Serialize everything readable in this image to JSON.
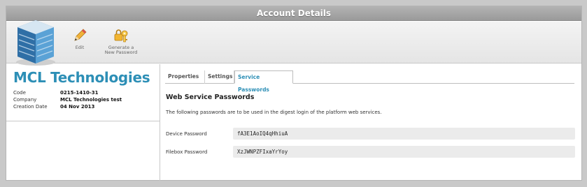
{
  "window": {
    "title": "Account Details"
  },
  "toolbar": {
    "edit_label": "Edit",
    "generate_label_line1": "Generate a",
    "generate_label_line2": "New Password"
  },
  "account": {
    "name": "MCL Technologies",
    "fields": [
      {
        "label": "Code",
        "value": "0215-1410-31"
      },
      {
        "label": "Company",
        "value": "MCL Technologies test"
      },
      {
        "label": "Creation Date",
        "value": "04 Nov 2013"
      }
    ]
  },
  "tabs": [
    {
      "label": "Properties",
      "active": false
    },
    {
      "label": "Settings",
      "active": false
    },
    {
      "label": "Service Passwords",
      "active": true
    }
  ],
  "service_passwords": {
    "title": "Web Service Passwords",
    "description": "The following passwords are to be used in the digest login of the platform web services.",
    "device": {
      "label": "Device Password",
      "value": "fA3E1AoIQ4qHhiuA"
    },
    "filebox": {
      "label": "Filebox Password",
      "value": "XzJWNPZFIxaYrYoy"
    }
  },
  "colors": {
    "accent": "#2d8fb6",
    "titlebar": "#a8a8a8",
    "field_bg": "#ebebeb"
  },
  "icons": [
    "building-logo-icon",
    "pencil-icon",
    "key-lock-icon"
  ]
}
